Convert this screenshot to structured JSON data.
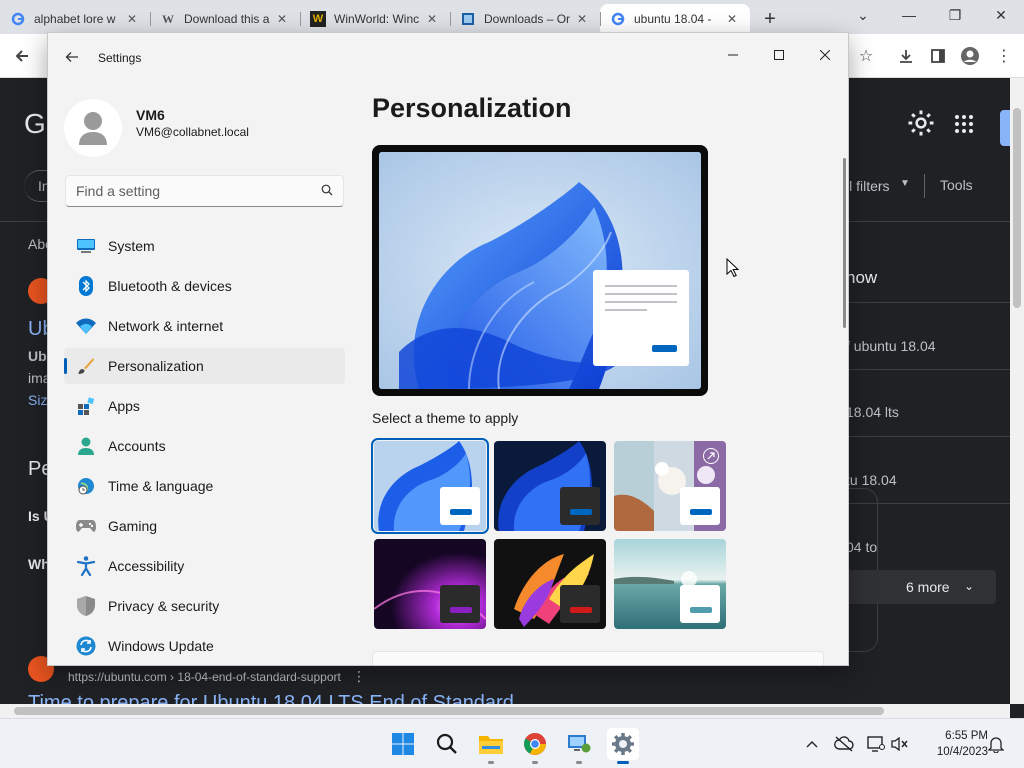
{
  "browser": {
    "tabs": [
      {
        "title": "alphabet lore w",
        "favicon": "google-icon",
        "active": false
      },
      {
        "title": "Download this a",
        "favicon": "wikipedia-icon",
        "active": false
      },
      {
        "title": "WinWorld: Winc",
        "favicon": "winworld-icon",
        "active": false
      },
      {
        "title": "Downloads – Or",
        "favicon": "oracle-icon",
        "active": false
      },
      {
        "title": "ubuntu 18.04 -",
        "favicon": "google-icon",
        "active": true
      }
    ],
    "new_tab_label": "+",
    "page": {
      "logo_letter": "G",
      "filter_tab": "In",
      "all_filters": "ll filters",
      "tools": "Tools",
      "about": "Abo",
      "result_title_fragment": "Ub",
      "result_bold": "Ub",
      "result_line": "ima",
      "result_size": "Siz",
      "people_heading": "Pe",
      "q1": "Is U",
      "q2": "Wh",
      "side_heading": "now",
      "side_items": [
        "f ubuntu 18.04",
        "18.04 lts",
        "tu 18.04",
        "04 to"
      ],
      "more_button": "6 more",
      "bottom_url": "https://ubuntu.com › 18-04-end-of-standard-support",
      "bottom_title": "Time to prepare for Ubuntu 18.04 LTS End of Standard"
    }
  },
  "settings": {
    "window_title": "Settings",
    "user": {
      "name": "VM6",
      "email": "VM6@collabnet.local"
    },
    "search_placeholder": "Find a setting",
    "nav": [
      {
        "label": "System",
        "icon": "monitor-icon"
      },
      {
        "label": "Bluetooth & devices",
        "icon": "bluetooth-icon"
      },
      {
        "label": "Network & internet",
        "icon": "wifi-icon"
      },
      {
        "label": "Personalization",
        "icon": "paintbrush-icon",
        "selected": true
      },
      {
        "label": "Apps",
        "icon": "apps-icon"
      },
      {
        "label": "Accounts",
        "icon": "person-icon"
      },
      {
        "label": "Time & language",
        "icon": "globe-clock-icon"
      },
      {
        "label": "Gaming",
        "icon": "gamepad-icon"
      },
      {
        "label": "Accessibility",
        "icon": "accessibility-icon"
      },
      {
        "label": "Privacy & security",
        "icon": "shield-icon"
      },
      {
        "label": "Windows Update",
        "icon": "update-icon"
      }
    ],
    "page_title": "Personalization",
    "theme_section_label": "Select a theme to apply",
    "themes": [
      {
        "id": "windows-light",
        "selected": true,
        "mini_window": "#ffffff",
        "accent": "#0067c0"
      },
      {
        "id": "windows-dark",
        "selected": false,
        "mini_window": "#2b2b2b",
        "accent": "#0067c0"
      },
      {
        "id": "glow",
        "selected": false,
        "mini_window": "#ffffff",
        "accent": "#0067c0"
      },
      {
        "id": "captured-motion",
        "selected": false,
        "mini_window": "#2b2b2b",
        "accent": "#8a20c0"
      },
      {
        "id": "flow",
        "selected": false,
        "mini_window": "#2b2b2b",
        "accent": "#d11a1a"
      },
      {
        "id": "sunrise",
        "selected": false,
        "mini_window": "#ffffff",
        "accent": "#4f9cad"
      }
    ],
    "accent_color": "#005fb8"
  },
  "taskbar": {
    "time": "6:55 PM",
    "date": "10/4/2023",
    "apps": [
      "start-icon",
      "search-icon",
      "file-explorer-icon",
      "chrome-icon",
      "remote-desktop-icon",
      "settings-icon"
    ]
  }
}
